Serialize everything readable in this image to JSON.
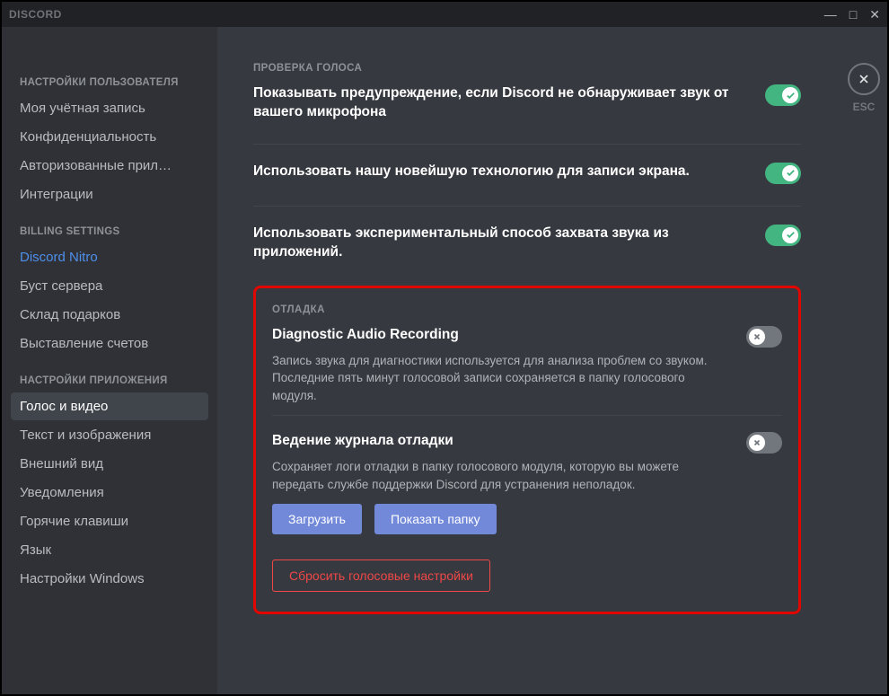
{
  "app": {
    "title": "DISCORD"
  },
  "sidebar": {
    "groups": [
      {
        "header": "НАСТРОЙКИ ПОЛЬЗОВАТЕЛЯ",
        "items": [
          "Моя учётная запись",
          "Конфиденциальность",
          "Авторизованные прил…",
          "Интеграции"
        ]
      },
      {
        "header": "BILLING SETTINGS",
        "items": [
          "Discord Nitro",
          "Буст сервера",
          "Склад подарков",
          "Выставление счетов"
        ]
      },
      {
        "header": "НАСТРОЙКИ ПРИЛОЖЕНИЯ",
        "items": [
          "Голос и видео",
          "Текст и изображения",
          "Внешний вид",
          "Уведомления",
          "Горячие клавиши",
          "Язык",
          "Настройки Windows"
        ]
      }
    ]
  },
  "content": {
    "voice_check_header": "ПРОВЕРКА ГОЛОСА",
    "settings": [
      {
        "title": "Показывать предупреждение, если Discord не обнаруживает звук от вашего микрофона",
        "on": true
      },
      {
        "title": "Использовать нашу новейшую технологию для записи экрана.",
        "on": true
      },
      {
        "title": "Использовать экспериментальный способ захвата звука из приложений.",
        "on": true
      }
    ],
    "debug_header": "ОТЛАДКА",
    "debug": [
      {
        "title": "Diagnostic Audio Recording",
        "desc": "Запись звука для диагностики используется для анализа проблем со звуком. Последние пять минут голосовой записи сохраняется в папку голосового модуля.",
        "on": false
      },
      {
        "title": "Ведение журнала отладки",
        "desc": "Сохраняет логи отладки в папку голосового модуля, которую вы можете передать службе поддержки Discord для устранения неполадок.",
        "on": false
      }
    ],
    "buttons": {
      "upload": "Загрузить",
      "show_folder": "Показать папку",
      "reset": "Сбросить голосовые настройки"
    },
    "esc_label": "ESC"
  }
}
